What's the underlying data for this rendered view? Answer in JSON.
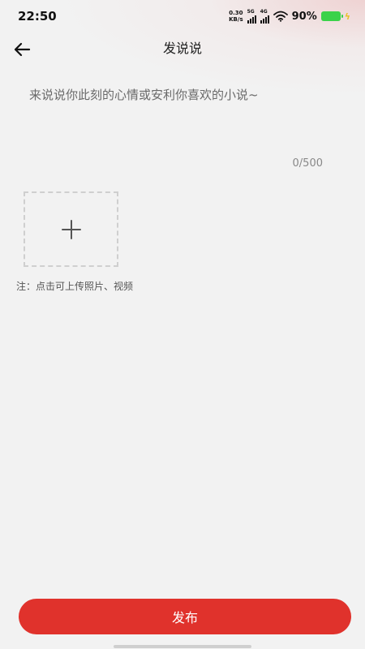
{
  "status_bar": {
    "time": "22:50",
    "net_speed_value": "0.30",
    "net_speed_unit": "KB/s",
    "signal_1_label": "5G",
    "signal_2_label": "4G",
    "battery_percent": "90%"
  },
  "header": {
    "title": "发说说",
    "back_icon": "arrow-left-icon"
  },
  "editor": {
    "placeholder": "来说说你此刻的心情或安利你喜欢的小说~",
    "value": "",
    "char_count": "0/500"
  },
  "upload": {
    "icon": "plus-icon",
    "note": "注：点击可上传照片、视频"
  },
  "footer": {
    "publish_label": "发布"
  },
  "colors": {
    "accent": "#e0322c",
    "background": "#f2f2f2",
    "battery": "#3ad24a"
  }
}
